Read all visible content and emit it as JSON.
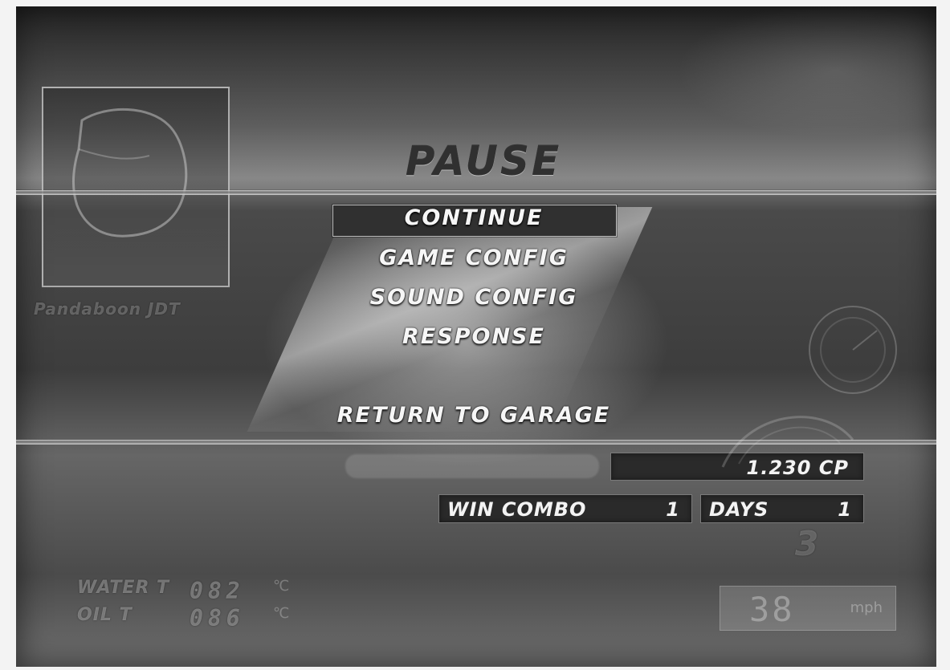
{
  "pause_menu": {
    "title": "PAUSE",
    "items": [
      {
        "label": "CONTINUE",
        "selected": true
      },
      {
        "label": "GAME CONFIG",
        "selected": false
      },
      {
        "label": "SOUND CONFIG",
        "selected": false
      },
      {
        "label": "RESPONSE",
        "selected": false
      },
      {
        "label": "RETURN TO GARAGE",
        "selected": false
      }
    ]
  },
  "stats": {
    "cp_value": "1.230 CP",
    "win_combo_label": "WIN COMBO",
    "win_combo_value": "1",
    "days_label": "DAYS",
    "days_value": "1"
  },
  "hud": {
    "car_name": "Pandaboon JDT",
    "water_label": "WATER T",
    "water_value": "082",
    "oil_label": "OIL T",
    "oil_value": "086",
    "temp_unit": "℃",
    "gear": "3",
    "speed_value": "38",
    "speed_unit": "mph"
  }
}
